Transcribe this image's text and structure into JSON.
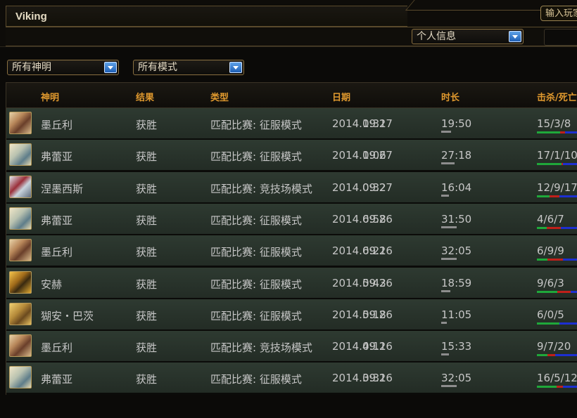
{
  "header": {
    "player_name": "Viking",
    "search_button": "输入玩家名称",
    "profile_dropdown": "个人信息"
  },
  "filters": {
    "gods": "所有神明",
    "modes": "所有模式"
  },
  "table": {
    "columns": [
      "神明",
      "结果",
      "类型",
      "日期",
      "时长",
      "击杀/死亡/助攻"
    ],
    "rows": [
      {
        "god": "墨丘利",
        "result": "获胜",
        "type": "匹配比赛: 征服模式",
        "date": "2014.09.27",
        "time": "1:31",
        "duration": "19:50",
        "duration_fraction": 0.45,
        "kda": "15/3/8",
        "kda_values": [
          15,
          3,
          8
        ],
        "avatar": "mercury-icon"
      },
      {
        "god": "弗蕾亚",
        "result": "获胜",
        "type": "匹配比赛: 征服模式",
        "date": "2014.09.27",
        "time": "1:06",
        "duration": "27:18",
        "duration_fraction": 0.62,
        "kda": "17/1/10",
        "kda_values": [
          17,
          1,
          10
        ],
        "avatar": "freya-icon"
      },
      {
        "god": "涅墨西斯",
        "result": "获胜",
        "type": "匹配比赛: 竞技场模式",
        "date": "2014.09.27",
        "time": "0:32",
        "duration": "16:04",
        "duration_fraction": 0.36,
        "kda": "12/9/17",
        "kda_values": [
          12,
          9,
          17
        ],
        "avatar": "nemesis-icon"
      },
      {
        "god": "弗蕾亚",
        "result": "获胜",
        "type": "匹配比赛: 征服模式",
        "date": "2014.09.26",
        "time": "6:58",
        "duration": "31:50",
        "duration_fraction": 0.72,
        "kda": "4/6/7",
        "kda_values": [
          4,
          6,
          7
        ],
        "avatar": "freya-icon"
      },
      {
        "god": "墨丘利",
        "result": "获胜",
        "type": "匹配比赛: 征服模式",
        "date": "2014.09.26",
        "time": "6:21",
        "duration": "32:05",
        "duration_fraction": 0.73,
        "kda": "6/9/9",
        "kda_values": [
          6,
          9,
          9
        ],
        "avatar": "mercury-icon"
      },
      {
        "god": "安赫",
        "result": "获胜",
        "type": "匹配比赛: 征服模式",
        "date": "2014.09.26",
        "time": "5:43",
        "duration": "18:59",
        "duration_fraction": 0.43,
        "kda": "9/6/3",
        "kda_values": [
          9,
          6,
          3
        ],
        "avatar": "anhur-icon"
      },
      {
        "god": "猢安・巴茨",
        "result": "获胜",
        "type": "匹配比赛: 征服模式",
        "date": "2014.09.26",
        "time": "5:18",
        "duration": "11:05",
        "duration_fraction": 0.25,
        "kda": "6/0/5",
        "kda_values": [
          6,
          0,
          5
        ],
        "avatar": "hunbatz-icon"
      },
      {
        "god": "墨丘利",
        "result": "获胜",
        "type": "匹配比赛: 竞技场模式",
        "date": "2014.09.26",
        "time": "4:11",
        "duration": "15:33",
        "duration_fraction": 0.35,
        "kda": "9/7/20",
        "kda_values": [
          9,
          7,
          20
        ],
        "avatar": "mercury-icon"
      },
      {
        "god": "弗蕾亚",
        "result": "获胜",
        "type": "匹配比赛: 征服模式",
        "date": "2014.09.26",
        "time": "3:31",
        "duration": "32:05",
        "duration_fraction": 0.73,
        "kda": "16/5/12",
        "kda_values": [
          16,
          5,
          12
        ],
        "avatar": "freya-icon"
      }
    ]
  },
  "colors": {
    "header_text": "#e0992e",
    "kills": "#1fa83a",
    "deaths": "#c0201a",
    "assists": "#1d2fd0",
    "duration_bar": "#8d8d8d"
  }
}
